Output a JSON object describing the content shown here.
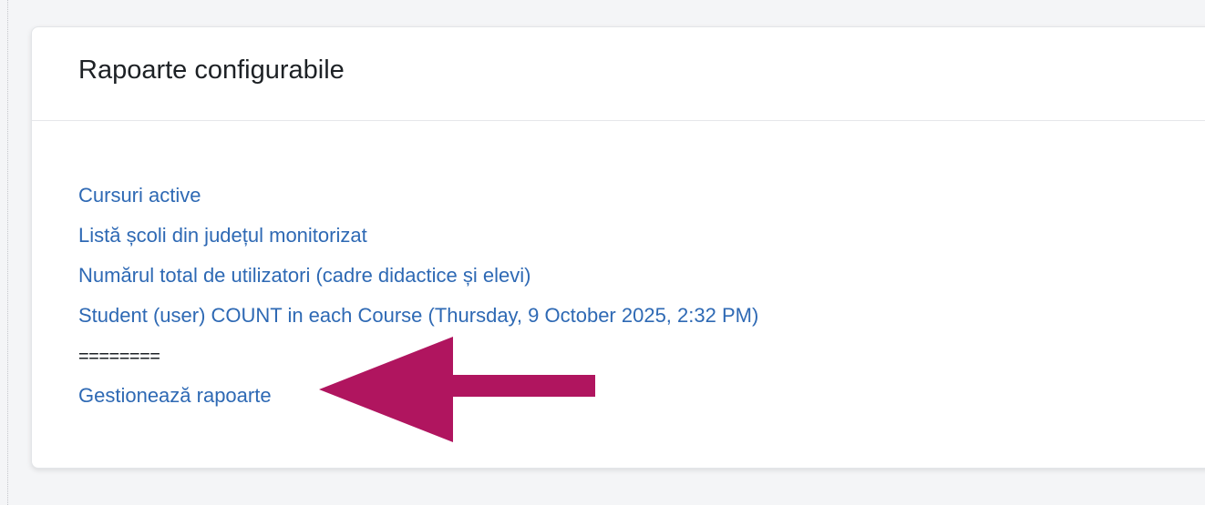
{
  "block": {
    "title": "Rapoarte configurabile"
  },
  "reports": [
    "Cursuri active",
    "Listă școli din județul monitorizat",
    "Numărul total de utilizatori (cadre didactice și elevi)",
    "Student (user) COUNT in each Course (Thursday, 9 October 2025, 2:32 PM)"
  ],
  "separator": "========",
  "manage_link": "Gestionează rapoarte",
  "colors": {
    "link": "#2e69b4",
    "annotation_arrow": "#b0155f"
  },
  "icons": {
    "annotation": "arrow-left-icon"
  }
}
